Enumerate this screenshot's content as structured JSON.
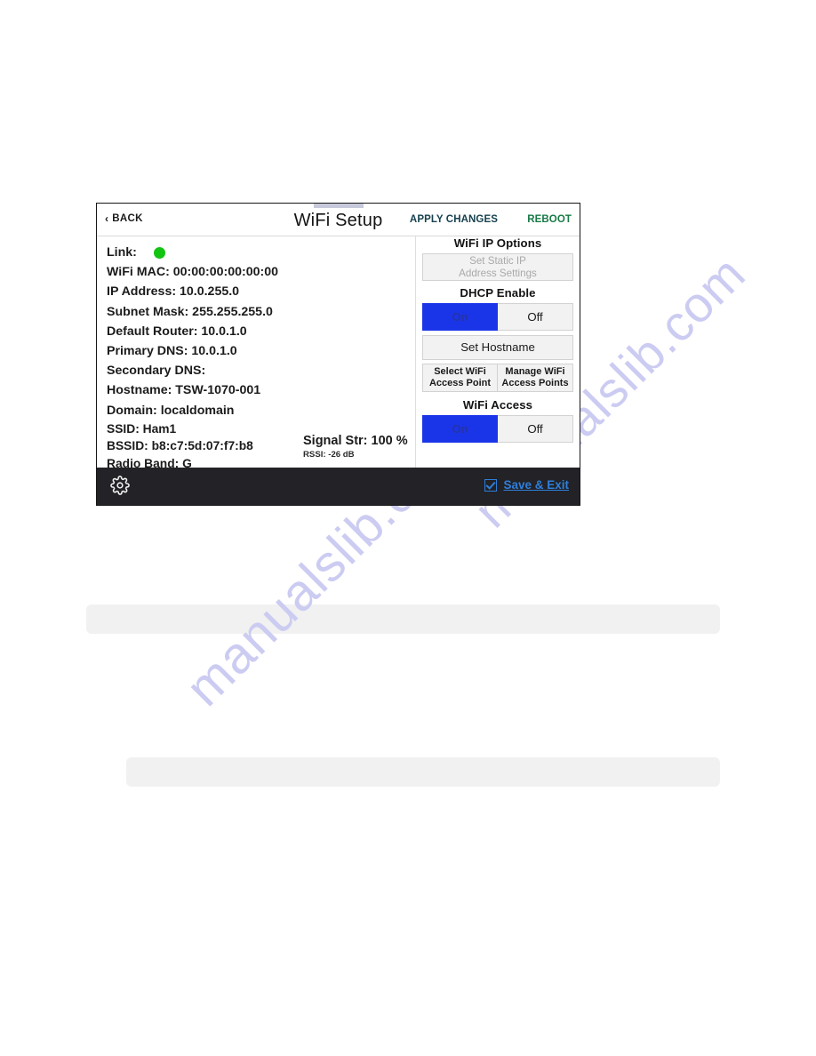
{
  "device_screen": {
    "header": {
      "back_label": "BACK",
      "back_chevron": "‹",
      "title": "WiFi Setup",
      "apply_changes_label": "APPLY CHANGES",
      "reboot_label": "REBOOT",
      "apply_changes_color": "#16424f",
      "reboot_color": "#177a46"
    },
    "info": {
      "rows": [
        {
          "label": "Link:",
          "value": "",
          "indicator": "green-dot"
        },
        {
          "label": "WiFi MAC:",
          "value": "00:00:00:00:00:00"
        },
        {
          "label": "IP Address:",
          "value": "10.0.255.0"
        },
        {
          "label": "Subnet Mask:",
          "value": "255.255.255.0"
        },
        {
          "label": "Default Router:",
          "value": "10.0.1.0"
        },
        {
          "label": "Primary DNS:",
          "value": "10.0.1.0"
        },
        {
          "label": "Secondary DNS:",
          "value": ""
        },
        {
          "label": "Hostname:",
          "value": "TSW-1070-001"
        },
        {
          "label": "Domain:",
          "value": "localdomain"
        },
        {
          "label": "SSID:",
          "value": "Ham1"
        },
        {
          "label": "BSSID:",
          "value": "b8:c7:5d:07:f7:b8"
        },
        {
          "label": "Radio Band:",
          "value": "G"
        }
      ],
      "text": {
        "link": "Link:",
        "wifi_mac": "WiFi MAC: 00:00:00:00:00:00",
        "ip_address": "IP Address: 10.0.255.0",
        "subnet_mask": "Subnet Mask: 255.255.255.0",
        "default_router": "Default Router: 10.0.1.0",
        "primary_dns": "Primary DNS: 10.0.1.0",
        "secondary_dns": "Secondary DNS:",
        "hostname": "Hostname: TSW-1070-001",
        "domain": "Domain: localdomain",
        "ssid": "SSID: Ham1",
        "bssid": "BSSID: b8:c7:5d:07:f7:b8",
        "radio_band": "Radio Band: G"
      },
      "link_status_color": "#12c412"
    },
    "signal": {
      "strength": "Signal Str: 100 %",
      "rssi": "RSSI: -26 dB"
    },
    "controls": {
      "ip_options_heading": "WiFi IP Options",
      "static_ip_line1": "Set Static IP",
      "static_ip_line2": "Address Settings",
      "dhcp_heading": "DHCP Enable",
      "dhcp_on_label": "On",
      "dhcp_off_label": "Off",
      "dhcp_selected": "On",
      "hostname_button_label": "Set Hostname",
      "select_ap_line1": "Select WiFi",
      "select_ap_line2": "Access Point",
      "manage_ap_line1": "Manage WiFi",
      "manage_ap_line2": "Access Points",
      "wifi_access_heading": "WiFi Access",
      "wifi_on_label": "On",
      "wifi_off_label": "Off",
      "wifi_selected": "On",
      "active_color": "#1a35e8"
    },
    "bottom_bar": {
      "gear_icon": "gear-icon",
      "save_exit_label": "Save & Exit",
      "save_exit_checked": true,
      "link_color": "#2f7fd8",
      "background_color": "#222227"
    }
  },
  "watermark": {
    "text_a": "manualslib.com",
    "text_b": "manualslib.com",
    "color": "#ccccf2"
  }
}
